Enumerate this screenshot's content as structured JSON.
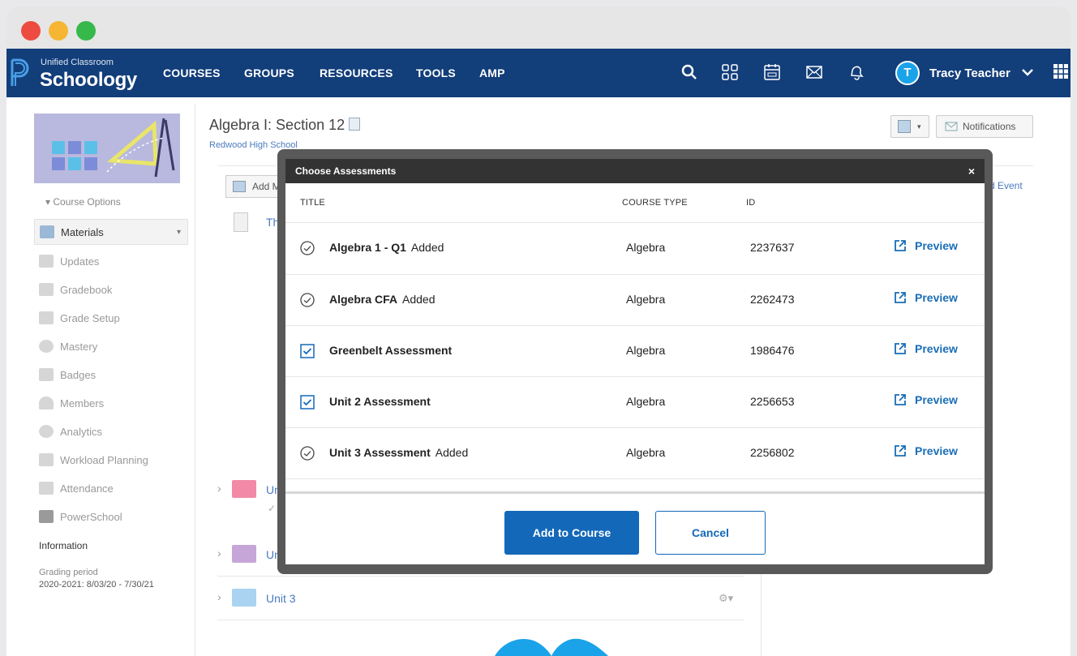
{
  "app": {
    "brand_sub": "Unified Classroom",
    "brand": "Schoology"
  },
  "nav": {
    "links": [
      "COURSES",
      "GROUPS",
      "RESOURCES",
      "TOOLS",
      "AMP"
    ],
    "user_initial": "T",
    "user_name": "Tracy Teacher"
  },
  "sidebar": {
    "course_options": "Course Options",
    "items": [
      {
        "label": "Materials"
      },
      {
        "label": "Updates"
      },
      {
        "label": "Gradebook"
      },
      {
        "label": "Grade Setup"
      },
      {
        "label": "Mastery"
      },
      {
        "label": "Badges"
      },
      {
        "label": "Members"
      },
      {
        "label": "Analytics"
      },
      {
        "label": "Workload Planning"
      },
      {
        "label": "Attendance"
      },
      {
        "label": "PowerSchool"
      }
    ],
    "info_title": "Information",
    "grading_label": "Grading period",
    "grading_value": "2020-2021: 8/03/20 - 7/30/21"
  },
  "course": {
    "title": "Algebra I: Section 12",
    "school": "Redwood High School",
    "add_materials": "Add Ma",
    "first_item": "The",
    "add_event": "d Event",
    "notifications": "Notifications",
    "folders": [
      {
        "label": "Unit",
        "color": "#f28aa6"
      },
      {
        "label": "Unit",
        "color": "#c6a6d9"
      },
      {
        "label": "Unit 3",
        "color": "#a9d3f0"
      }
    ]
  },
  "modal": {
    "title": "Choose Assessments",
    "close": "×",
    "headers": {
      "title": "TITLE",
      "course_type": "COURSE TYPE",
      "id": "ID"
    },
    "rows": [
      {
        "title": "Algebra 1 - Q1",
        "status": "Added",
        "course_type": "Algebra",
        "id": "2237637",
        "preview": "Preview"
      },
      {
        "title": "Algebra CFA",
        "status": "Added",
        "course_type": "Algebra",
        "id": "2262473",
        "preview": "Preview"
      },
      {
        "title": "Greenbelt Assessment",
        "status": "",
        "course_type": "Algebra",
        "id": "1986476",
        "preview": "Preview"
      },
      {
        "title": "Unit 2 Assessment",
        "status": "",
        "course_type": "Algebra",
        "id": "2256653",
        "preview": "Preview"
      },
      {
        "title": "Unit 3 Assessment",
        "status": "Added",
        "course_type": "Algebra",
        "id": "2256802",
        "preview": "Preview"
      }
    ],
    "primary": "Add to Course",
    "secondary": "Cancel"
  },
  "colors": {
    "nav_bg": "#123e7a",
    "accent": "#1468b9",
    "avatar": "#1aa3e8"
  }
}
